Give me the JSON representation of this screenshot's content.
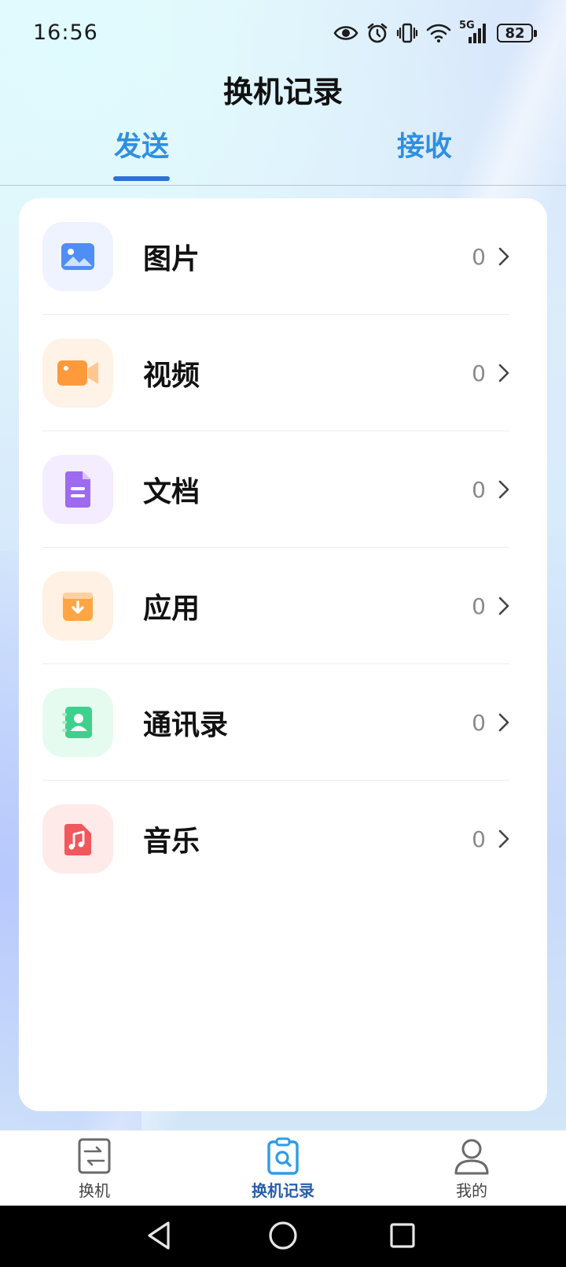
{
  "status_bar": {
    "time": "16:56",
    "network_label": "5G",
    "battery": "82",
    "icons": [
      "eye-icon",
      "alarm-icon",
      "vibrate-icon",
      "wifi-icon",
      "signal-icon",
      "battery-icon"
    ]
  },
  "header": {
    "title": "换机记录"
  },
  "tabs": [
    {
      "label": "发送",
      "active": true
    },
    {
      "label": "接收",
      "active": false
    }
  ],
  "items": [
    {
      "label": "图片",
      "count": "0",
      "icon": "image-icon",
      "color": "#4f8ff5"
    },
    {
      "label": "视频",
      "count": "0",
      "icon": "video-icon",
      "color": "#ff9a3c"
    },
    {
      "label": "文档",
      "count": "0",
      "icon": "document-icon",
      "color": "#9d6af0"
    },
    {
      "label": "应用",
      "count": "0",
      "icon": "app-download-icon",
      "color": "#ffa544"
    },
    {
      "label": "通讯录",
      "count": "0",
      "icon": "contacts-icon",
      "color": "#3ed08c"
    },
    {
      "label": "音乐",
      "count": "0",
      "icon": "music-icon",
      "color": "#f2575b"
    }
  ],
  "bottom_nav": [
    {
      "label": "换机",
      "icon": "switch-phone-icon",
      "active": false
    },
    {
      "label": "换机记录",
      "icon": "records-icon",
      "active": true
    },
    {
      "label": "我的",
      "icon": "profile-icon",
      "active": false
    }
  ],
  "colors": {
    "accent": "#2a73d8",
    "tab_text": "#2f8fe0",
    "active_nav": "#2a5ea8"
  }
}
